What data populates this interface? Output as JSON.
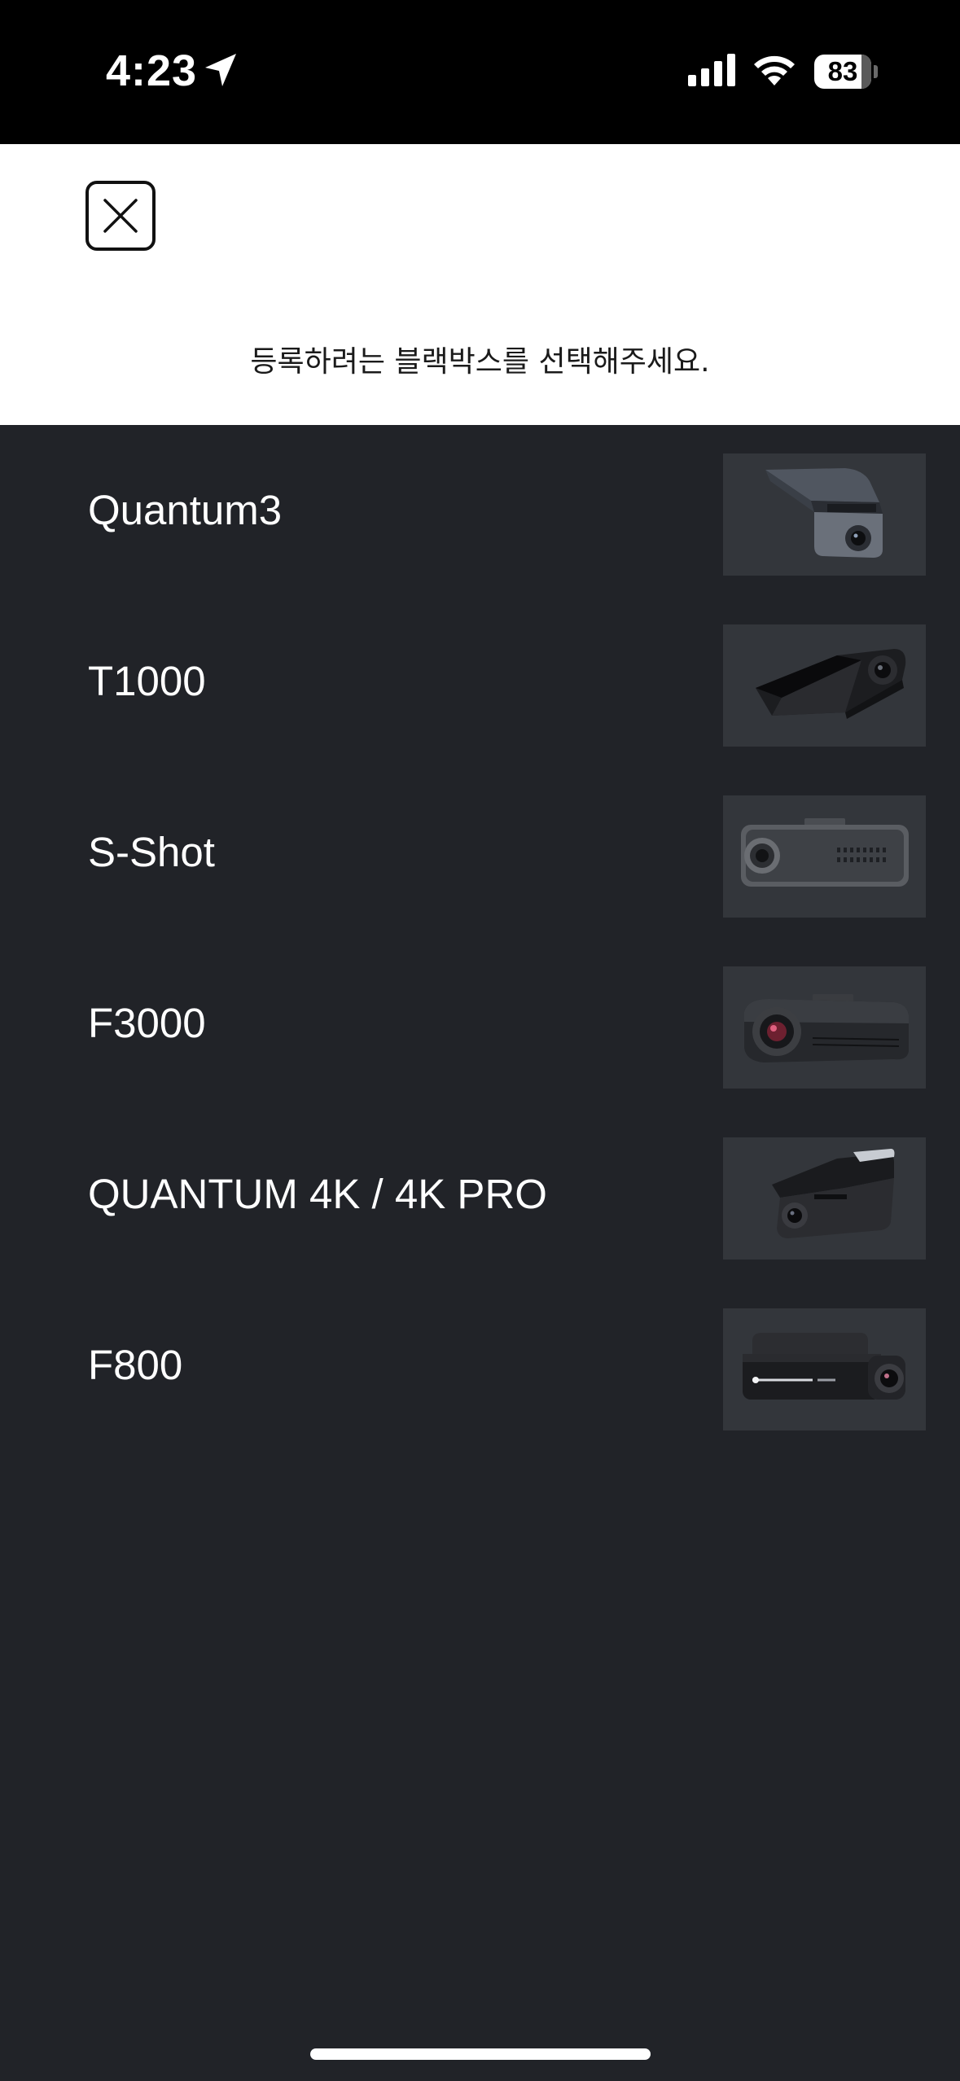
{
  "status_bar": {
    "time": "4:23",
    "battery": "83",
    "battery_level": 0.83,
    "icons": [
      "location-arrow-icon",
      "cellular-signal-icon",
      "wifi-icon",
      "battery-icon"
    ]
  },
  "header": {
    "close_icon": "close-icon",
    "title": "등록하려는 블랙박스를 선택해주세요."
  },
  "devices": [
    {
      "name": "Quantum3",
      "thumbnail": "dashcam-quantum3-image"
    },
    {
      "name": "T1000",
      "thumbnail": "dashcam-t1000-image"
    },
    {
      "name": "S-Shot",
      "thumbnail": "dashcam-s-shot-image"
    },
    {
      "name": "F3000",
      "thumbnail": "dashcam-f3000-image"
    },
    {
      "name": "QUANTUM 4K / 4K PRO",
      "thumbnail": "dashcam-quantum-4k-image"
    },
    {
      "name": "F800",
      "thumbnail": "dashcam-f800-image"
    }
  ],
  "colors": {
    "background": "#212328",
    "header_background": "#ffffff",
    "thumbnail_background": "#33363b",
    "status_bar_background": "#000000"
  }
}
